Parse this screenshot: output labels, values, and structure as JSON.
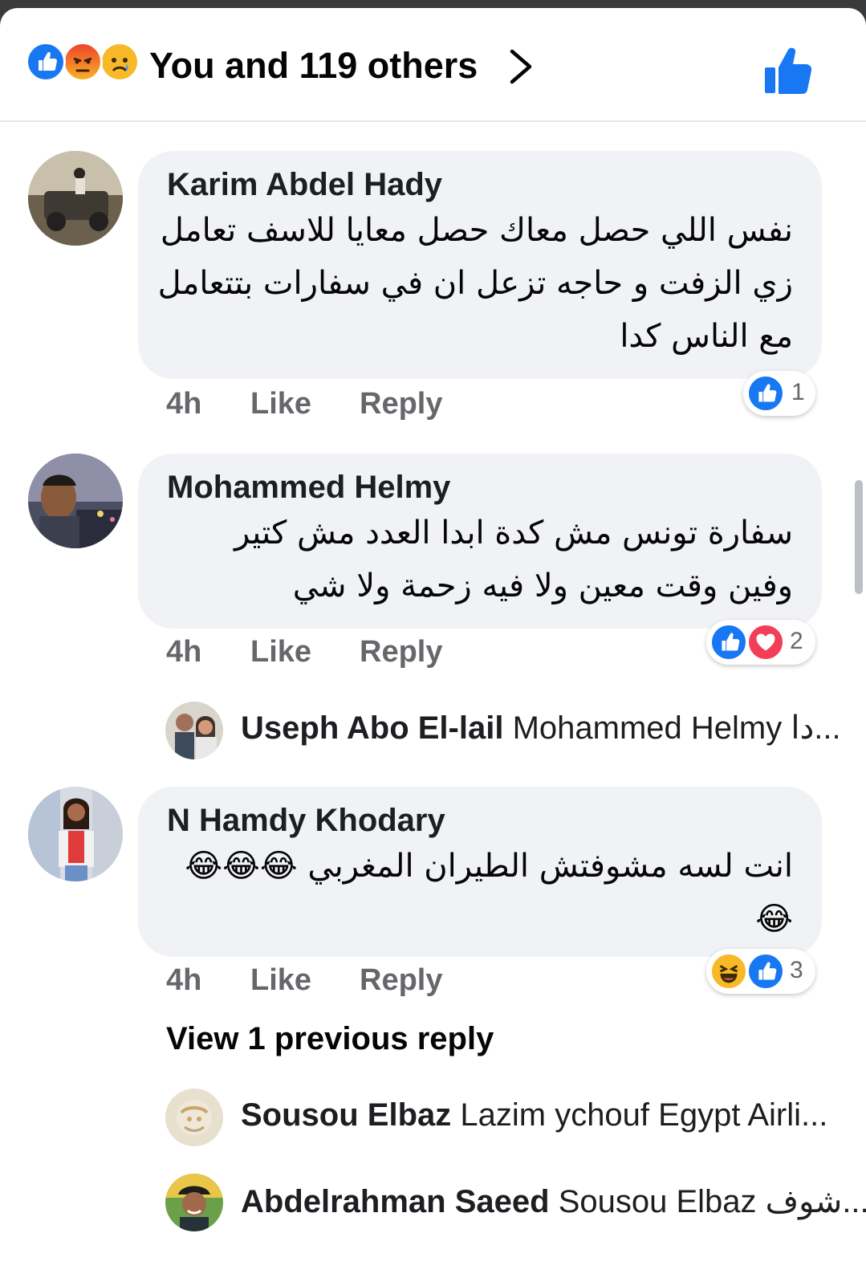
{
  "header": {
    "reactions": [
      "like-icon",
      "angry-icon",
      "sad-icon"
    ],
    "summary": "You and 119 others"
  },
  "colors": {
    "brand_blue": "#1877f2",
    "heart_red": "#f33e58",
    "bubble_bg": "#f0f2f5",
    "meta_gray": "#65676b"
  },
  "comments": [
    {
      "author": "Karim Abdel Hady",
      "lines": [
        "نفس اللي حصل معاك حصل معايا للاسف تعامل",
        "زي الزفت و حاجه تزعل ان في سفارات بتتعامل",
        "مع الناس كدا"
      ],
      "time": "4h",
      "like": "Like",
      "reply": "Reply",
      "reaction_count": "1"
    },
    {
      "author": "Mohammed Helmy",
      "lines": [
        "سفارة تونس مش كدة ابدا العدد مش كتير",
        "وفين وقت معين ولا فيه زحمة ولا شي"
      ],
      "time": "4h",
      "like": "Like",
      "reply": "Reply",
      "reaction_count": "2"
    },
    {
      "author": "N Hamdy Khodary",
      "lines": [
        "انت لسه مشوفتش الطيران المغربي 😂😂😂",
        "😂"
      ],
      "time": "4h",
      "like": "Like",
      "reply": "Reply",
      "reaction_count": "3"
    }
  ],
  "replies": [
    {
      "name": "Useph Abo El-lail",
      "text": "Mohammed Helmy دا..."
    },
    {
      "name": "Sousou Elbaz",
      "text": "Lazim ychouf Egypt Airli..."
    },
    {
      "name": "Abdelrahman Saeed",
      "text": "Sousou Elbaz شوف..."
    }
  ],
  "view_previous": "View 1 previous reply"
}
